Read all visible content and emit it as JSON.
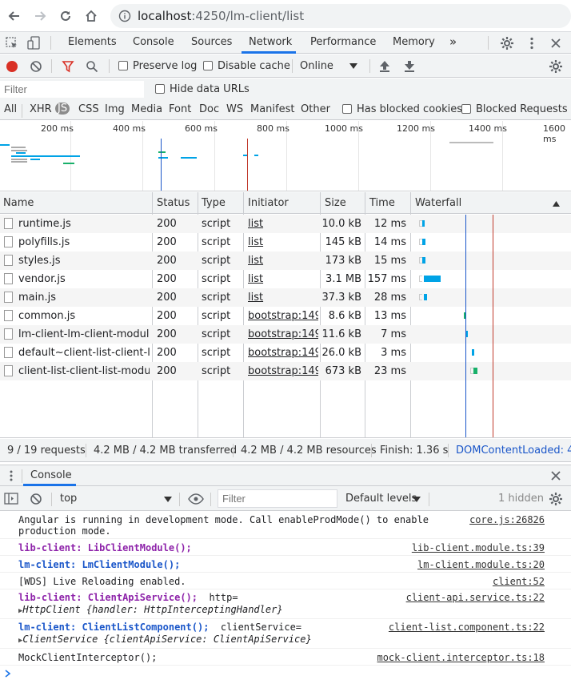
{
  "browser": {
    "url_host": "localhost",
    "url_path": ":4250/lm-client/list"
  },
  "devtools_tabs": [
    "Elements",
    "Console",
    "Sources",
    "Network",
    "Performance",
    "Memory"
  ],
  "devtools_more": "»",
  "network_toolbar": {
    "preserve_log": "Preserve log",
    "disable_cache": "Disable cache",
    "throttle": "Online"
  },
  "filter": {
    "placeholder": "Filter",
    "hide_data_urls": "Hide data URLs"
  },
  "type_filters": [
    "All",
    "XHR",
    "JS",
    "CSS",
    "Img",
    "Media",
    "Font",
    "Doc",
    "WS",
    "Manifest",
    "Other"
  ],
  "type_active": "JS",
  "has_blocked_cookies": "Has blocked cookies",
  "blocked_requests": "Blocked Requests",
  "overview_ticks": [
    "200 ms",
    "400 ms",
    "600 ms",
    "800 ms",
    "1000 ms",
    "1200 ms",
    "1400 ms",
    "1600 ms"
  ],
  "table": {
    "headers": [
      "Name",
      "Status",
      "Type",
      "Initiator",
      "Size",
      "Time",
      "Waterfall"
    ],
    "rows": [
      {
        "name": "runtime.js",
        "status": "200",
        "type": "script",
        "initiator": "list",
        "size": "10.0 kB",
        "time": "12 ms"
      },
      {
        "name": "polyfills.js",
        "status": "200",
        "type": "script",
        "initiator": "list",
        "size": "145 kB",
        "time": "14 ms"
      },
      {
        "name": "styles.js",
        "status": "200",
        "type": "script",
        "initiator": "list",
        "size": "173 kB",
        "time": "15 ms"
      },
      {
        "name": "vendor.js",
        "status": "200",
        "type": "script",
        "initiator": "list",
        "size": "3.1 MB",
        "time": "157 ms"
      },
      {
        "name": "main.js",
        "status": "200",
        "type": "script",
        "initiator": "list",
        "size": "37.3 kB",
        "time": "28 ms"
      },
      {
        "name": "common.js",
        "status": "200",
        "type": "script",
        "initiator": "bootstrap:149",
        "size": "8.6 kB",
        "time": "13 ms"
      },
      {
        "name": "lm-client-lm-client-modul…",
        "status": "200",
        "type": "script",
        "initiator": "bootstrap:149",
        "size": "11.6 kB",
        "time": "7 ms"
      },
      {
        "name": "default~client-list-client-l…",
        "status": "200",
        "type": "script",
        "initiator": "bootstrap:149",
        "size": "26.0 kB",
        "time": "3 ms"
      },
      {
        "name": "client-list-client-list-modu…",
        "status": "200",
        "type": "script",
        "initiator": "bootstrap:149",
        "size": "673 kB",
        "time": "23 ms"
      }
    ]
  },
  "status_bar": {
    "requests": "9 / 19 requests",
    "transferred": "4.2 MB / 4.2 MB transferred",
    "resources": "4.2 MB / 4.2 MB resources",
    "finish": "Finish: 1.36 s",
    "dom_content_loaded": "DOMContentLoaded: 4"
  },
  "drawer": {
    "tab": "Console"
  },
  "console_toolbar": {
    "context": "top",
    "filter_placeholder": "Filter",
    "levels": "Default levels",
    "hidden": "1 hidden"
  },
  "console_messages": [
    {
      "text": "Angular is running in development mode. Call enableProdMode() to enable\nproduction mode.",
      "source": "core.js:26826"
    },
    {
      "prefix": "lib-client:",
      "label": "LibClientModule();",
      "source": "lib-client.module.ts:39"
    },
    {
      "prefix": "lm-client:",
      "label": "LmClientModule();",
      "source": "lm-client.module.ts:20"
    },
    {
      "text": "[WDS] Live Reloading enabled.",
      "source": "client:52"
    },
    {
      "prefix": "lib-client:",
      "label": "ClientApiService();",
      "extra": "http=",
      "obj_class": "HttpClient",
      "obj_body": "{handler: HttpInterceptingHandler}",
      "source": "client-api.service.ts:22"
    },
    {
      "prefix": "lm-client:",
      "label": "ClientListComponent();",
      "extra": "clientService=",
      "obj_class": "ClientService",
      "obj_body": "{clientApiService: ClientApiService}",
      "source": "client-list.component.ts:22"
    },
    {
      "text": "MockClientInterceptor();",
      "source": "mock-client.interceptor.ts:18"
    }
  ],
  "colors": {
    "accent": "#1a73e8",
    "waterfall_bar": "#00a3e6",
    "dom_line": "#1a56c9",
    "load_line": "#c0392b",
    "purple": "#8e24aa"
  }
}
